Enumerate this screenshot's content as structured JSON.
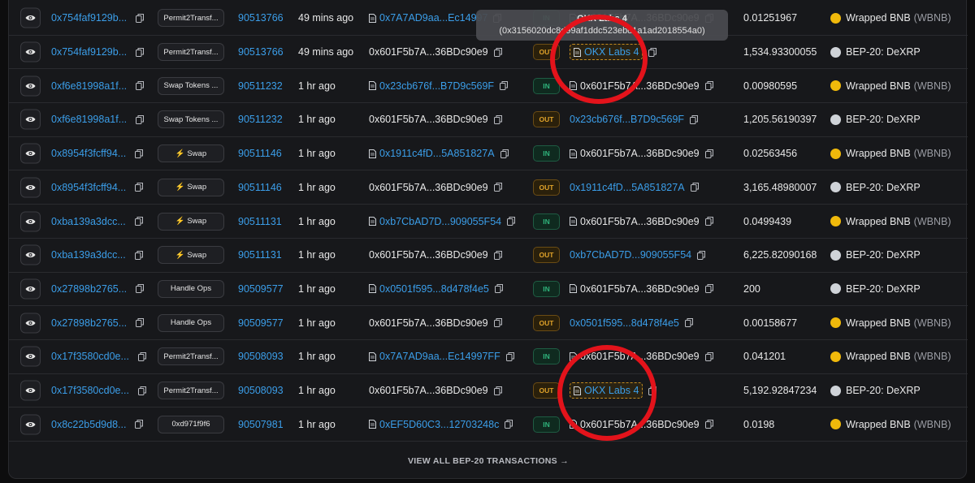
{
  "rows": [
    {
      "txn": "0x754faf9129b...",
      "method": "Permit2Transf...",
      "block": "90513766",
      "age": "49 mins ago",
      "from": "0x7A7AD9aa...Ec14997",
      "from_link": true,
      "dir": "IN",
      "to": "0x601F5b7A...36BDc90e9",
      "to_link": false,
      "to_label": false,
      "amount": "0.01251967",
      "token": "Wrapped BNB",
      "symbol": "(WBNB)",
      "token_color": "gold"
    },
    {
      "txn": "0x754faf9129b...",
      "method": "Permit2Transf...",
      "block": "90513766",
      "age": "49 mins ago",
      "from": "0x601F5b7A...36BDc90e9",
      "from_link": false,
      "dir": "OUT",
      "to": "OKX Labs 4",
      "to_link": true,
      "to_label": true,
      "amount": "1,534.93300055",
      "token": "BEP-20: DeXRP",
      "symbol": "",
      "token_color": "grey"
    },
    {
      "txn": "0xf6e81998a1f...",
      "method": "Swap Tokens ...",
      "block": "90511232",
      "age": "1 hr ago",
      "from": "0x23cb676f...B7D9c569F",
      "from_link": true,
      "dir": "IN",
      "to": "0x601F5b7A...36BDc90e9",
      "to_link": false,
      "to_label": false,
      "amount": "0.00980595",
      "token": "Wrapped BNB",
      "symbol": "(WBNB)",
      "token_color": "gold"
    },
    {
      "txn": "0xf6e81998a1f...",
      "method": "Swap Tokens ...",
      "block": "90511232",
      "age": "1 hr ago",
      "from": "0x601F5b7A...36BDc90e9",
      "from_link": false,
      "dir": "OUT",
      "to": "0x23cb676f...B7D9c569F",
      "to_link": true,
      "to_label": false,
      "amount": "1,205.56190397",
      "token": "BEP-20: DeXRP",
      "symbol": "",
      "token_color": "grey"
    },
    {
      "txn": "0x8954f3fcff94...",
      "method": "⚡ Swap",
      "block": "90511146",
      "age": "1 hr ago",
      "from": "0x1911c4fD...5A851827A",
      "from_link": true,
      "dir": "IN",
      "to": "0x601F5b7A...36BDc90e9",
      "to_link": false,
      "to_label": false,
      "amount": "0.02563456",
      "token": "Wrapped BNB",
      "symbol": "(WBNB)",
      "token_color": "gold"
    },
    {
      "txn": "0x8954f3fcff94...",
      "method": "⚡ Swap",
      "block": "90511146",
      "age": "1 hr ago",
      "from": "0x601F5b7A...36BDc90e9",
      "from_link": false,
      "dir": "OUT",
      "to": "0x1911c4fD...5A851827A",
      "to_link": true,
      "to_label": false,
      "amount": "3,165.48980007",
      "token": "BEP-20: DeXRP",
      "symbol": "",
      "token_color": "grey"
    },
    {
      "txn": "0xba139a3dcc...",
      "method": "⚡ Swap",
      "block": "90511131",
      "age": "1 hr ago",
      "from": "0xb7CbAD7D...909055F54",
      "from_link": true,
      "dir": "IN",
      "to": "0x601F5b7A...36BDc90e9",
      "to_link": false,
      "to_label": false,
      "amount": "0.0499439",
      "token": "Wrapped BNB",
      "symbol": "(WBNB)",
      "token_color": "gold"
    },
    {
      "txn": "0xba139a3dcc...",
      "method": "⚡ Swap",
      "block": "90511131",
      "age": "1 hr ago",
      "from": "0x601F5b7A...36BDc90e9",
      "from_link": false,
      "dir": "OUT",
      "to": "0xb7CbAD7D...909055F54",
      "to_link": true,
      "to_label": false,
      "amount": "6,225.82090168",
      "token": "BEP-20: DeXRP",
      "symbol": "",
      "token_color": "grey"
    },
    {
      "txn": "0x27898b2765...",
      "method": "Handle Ops",
      "block": "90509577",
      "age": "1 hr ago",
      "from": "0x0501f595...8d478f4e5",
      "from_link": true,
      "dir": "IN",
      "to": "0x601F5b7A...36BDc90e9",
      "to_link": false,
      "to_label": false,
      "amount": "200",
      "token": "BEP-20: DeXRP",
      "symbol": "",
      "token_color": "grey"
    },
    {
      "txn": "0x27898b2765...",
      "method": "Handle Ops",
      "block": "90509577",
      "age": "1 hr ago",
      "from": "0x601F5b7A...36BDc90e9",
      "from_link": false,
      "dir": "OUT",
      "to": "0x0501f595...8d478f4e5",
      "to_link": true,
      "to_label": false,
      "amount": "0.00158677",
      "token": "Wrapped BNB",
      "symbol": "(WBNB)",
      "token_color": "gold"
    },
    {
      "txn": "0x17f3580cd0e...",
      "method": "Permit2Transf...",
      "block": "90508093",
      "age": "1 hr ago",
      "from": "0x7A7AD9aa...Ec14997FF",
      "from_link": true,
      "dir": "IN",
      "to": "0x601F5b7A...36BDc90e9",
      "to_link": false,
      "to_label": false,
      "amount": "0.041201",
      "token": "Wrapped BNB",
      "symbol": "(WBNB)",
      "token_color": "gold"
    },
    {
      "txn": "0x17f3580cd0e...",
      "method": "Permit2Transf...",
      "block": "90508093",
      "age": "1 hr ago",
      "from": "0x601F5b7A...36BDc90e9",
      "from_link": false,
      "dir": "OUT",
      "to": "OKX Labs 4",
      "to_link": true,
      "to_label": true,
      "amount": "5,192.92847234",
      "token": "BEP-20: DeXRP",
      "symbol": "",
      "token_color": "grey"
    },
    {
      "txn": "0x8c22b5d9d8...",
      "method": "0xd971f9f6",
      "block": "90507981",
      "age": "1 hr ago",
      "from": "0xEF5D60C3...12703248c",
      "from_link": true,
      "dir": "IN",
      "to": "0x601F5b7A...36BDc90e9",
      "to_link": false,
      "to_label": false,
      "amount": "0.0198",
      "token": "Wrapped BNB",
      "symbol": "(WBNB)",
      "token_color": "gold"
    }
  ],
  "tooltip": {
    "title": "OKX Labs 4",
    "address": "(0x3156020dc8d99af1ddc523ebd1a1ad2018554a0)"
  },
  "footer": {
    "label": "VIEW ALL BEP-20 TRANSACTIONS →"
  },
  "colors": {
    "link": "#3b9ee9",
    "in": "#2fb47c",
    "out": "#e1a32a",
    "highlight": "#e3131b"
  }
}
